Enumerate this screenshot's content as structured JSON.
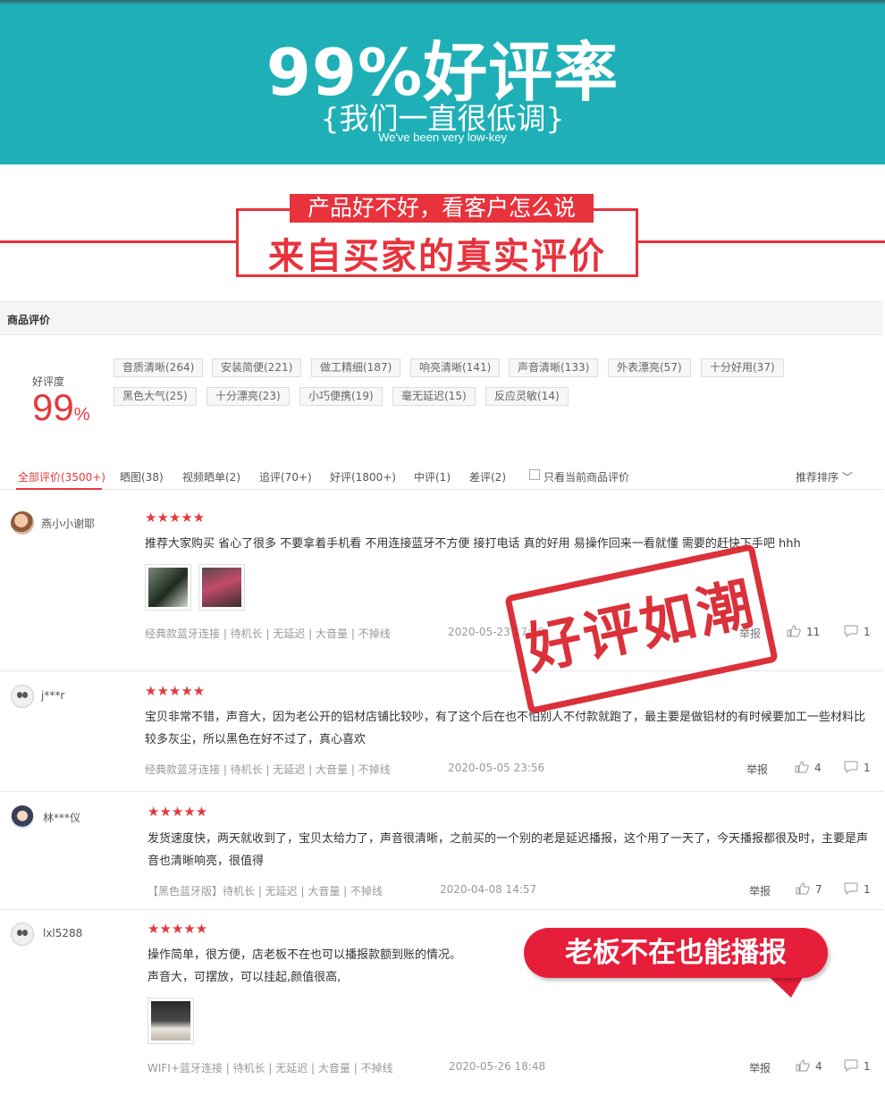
{
  "banner": {
    "title": "99%好评率",
    "subtitle": "{我们一直很低调}",
    "subtitle_en": "We've been very low-key"
  },
  "section": {
    "tagline": "产品好不好，看客户怎么说",
    "heading": "来自买家的真实评价"
  },
  "panel": {
    "title": "商品评价",
    "rating_label": "好评度",
    "rating_value": "99",
    "rating_unit": "%",
    "tags": [
      "音质清晰(264)",
      "安装简便(221)",
      "做工精细(187)",
      "响亮清晰(141)",
      "声音清晰(133)",
      "外表漂亮(57)",
      "十分好用(37)",
      "黑色大气(25)",
      "十分漂亮(23)",
      "小巧便携(19)",
      "毫无延迟(15)",
      "反应灵敏(14)"
    ]
  },
  "filters": {
    "items": [
      "全部评价(3500+)",
      "晒图(38)",
      "视频晒单(2)",
      "追评(70+)",
      "好评(1800+)",
      "中评(1)",
      "差评(2)"
    ],
    "only_current": "只看当前商品评价",
    "sort": "推荐排序"
  },
  "reviews": [
    {
      "user": "燕小小谢耶",
      "stars": "★★★★★",
      "text": "推荐大家购买 省心了很多 不要拿着手机看 不用连接蓝牙不方便 接打电话 真的好用 易操作回来一看就懂 需要的赶快下手吧 hhh",
      "meta": "经典款蓝牙连接 | 待机长 | 无延迟 | 大音量 | 不掉线",
      "date": "2020-05-23 17:19",
      "report": "举报",
      "likes": "11",
      "comments": "1"
    },
    {
      "user": "j***r",
      "stars": "★★★★★",
      "text": "宝贝非常不错，声音大，因为老公开的铝材店铺比较吵，有了这个后在也不怕别人不付款就跑了，最主要是做铝材的有时候要加工一些材料比较多灰尘，所以黑色在好不过了，真心喜欢",
      "meta": "经典款蓝牙连接 | 待机长 | 无延迟 | 大音量 | 不掉线",
      "date": "2020-05-05 23:56",
      "report": "举报",
      "likes": "4",
      "comments": "1"
    },
    {
      "user": "林***仪",
      "stars": "★★★★★",
      "text": "发货速度快，两天就收到了，宝贝太给力了，声音很清晰，之前买的一个别的老是延迟播报，这个用了一天了，今天播报都很及时，主要是声音也清晰响亮，很值得",
      "meta": "【黑色蓝牙版】待机长 | 无延迟 | 大音量 | 不掉线",
      "date": "2020-04-08 14:57",
      "report": "举报",
      "likes": "7",
      "comments": "1"
    },
    {
      "user": "lxl5288",
      "stars": "★★★★★",
      "text_line1": "操作简单，很方便，店老板不在也可以播报款额到账的情况。",
      "text_line2": "声音大，可摆放，可以挂起,颜值很高,",
      "meta": "WIFI+蓝牙连接 | 待机长 | 无延迟 | 大音量 | 不掉线",
      "date": "2020-05-26 18:48",
      "report": "举报",
      "likes": "4",
      "comments": "1"
    }
  ],
  "overlays": {
    "stamp": "好评如潮",
    "bubble": "老板不在也能播报"
  },
  "colors": {
    "banner_teal": "#1fb0b7",
    "accent_red": "#e4393c",
    "bubble_red": "#e61e3a"
  }
}
